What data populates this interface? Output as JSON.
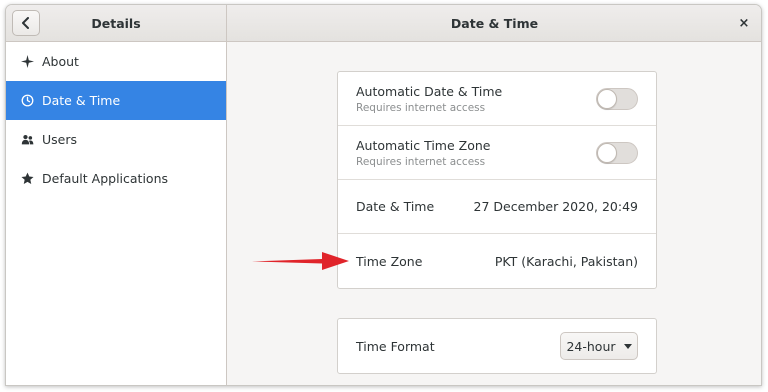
{
  "header": {
    "sidebar_title": "Details",
    "title": "Date & Time",
    "back_icon": "chevron-left-icon",
    "close_label": "×"
  },
  "sidebar": {
    "items": [
      {
        "label": "About",
        "icon": "sparkle-icon",
        "active": false
      },
      {
        "label": "Date & Time",
        "icon": "clock-icon",
        "active": true
      },
      {
        "label": "Users",
        "icon": "users-icon",
        "active": false
      },
      {
        "label": "Default Applications",
        "icon": "star-icon",
        "active": false
      }
    ]
  },
  "main": {
    "auto_datetime": {
      "title": "Automatic Date & Time",
      "subtitle": "Requires internet access",
      "enabled": false
    },
    "auto_timezone": {
      "title": "Automatic Time Zone",
      "subtitle": "Requires internet access",
      "enabled": false
    },
    "datetime": {
      "label": "Date & Time",
      "value": "27 December 2020, 20:49"
    },
    "timezone": {
      "label": "Time Zone",
      "value": "PKT (Karachi, Pakistan)"
    },
    "time_format": {
      "label": "Time Format",
      "value": "24-hour"
    }
  },
  "colors": {
    "accent": "#3584e4",
    "annotation_arrow": "#e0242a"
  }
}
